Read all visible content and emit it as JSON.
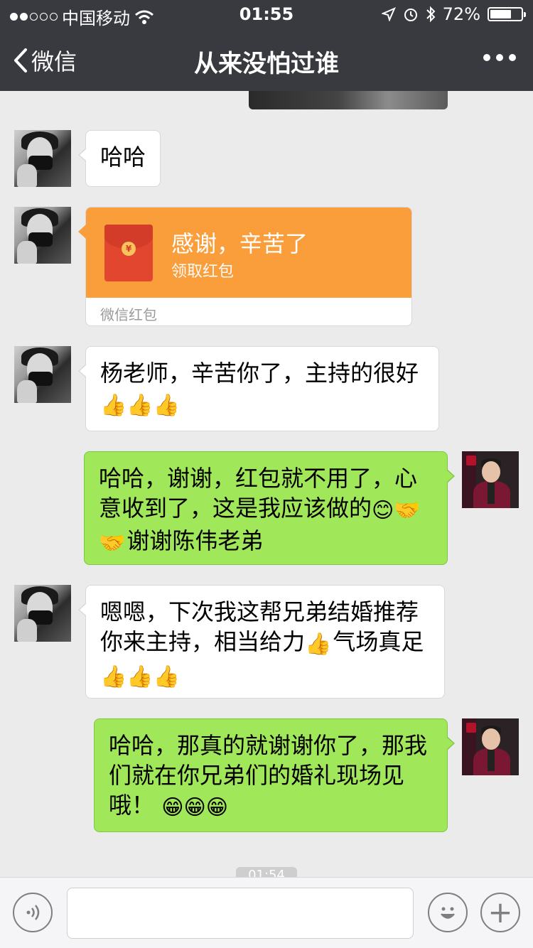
{
  "status_bar": {
    "carrier": "中国移动",
    "time": "01:55",
    "battery_percent": "72%",
    "battery_level": 0.72
  },
  "nav": {
    "back_label": "微信",
    "title": "从来没怕过谁",
    "more_icon": "more-dots-icon"
  },
  "messages": [
    {
      "side": "left",
      "text": "哈哈"
    },
    {
      "side": "left",
      "type": "red_packet",
      "title": "感谢，辛苦了",
      "subtitle": "领取红包",
      "footer": "微信红包"
    },
    {
      "side": "left",
      "text": "杨老师，辛苦你了，主持的很好",
      "emojis": "👍👍👍"
    },
    {
      "side": "right",
      "line1": "哈哈，谢谢，红包就不用了，心",
      "line2": "意收到了，这是我应该做的",
      "line2_emojis": "😊🤝",
      "line3_emoji": "🤝",
      "line3": "谢谢陈伟老弟"
    },
    {
      "side": "left",
      "line1": "嗯嗯，下次我这帮兄弟结婚推荐",
      "line2_a": "你来主持，相当给力",
      "line2_emoji": "👍",
      "line2_b": "气场真足",
      "emojis": "👍👍👍"
    },
    {
      "side": "right",
      "line1": "哈哈，那真的就谢谢你了，那我",
      "line2": "们就在你兄弟们的婚礼现场见",
      "line3": "哦！",
      "emojis": "😁😁😁"
    }
  ],
  "timestamp_peek": "01:54",
  "input_bar": {
    "placeholder": "",
    "plus_symbol": "+"
  }
}
